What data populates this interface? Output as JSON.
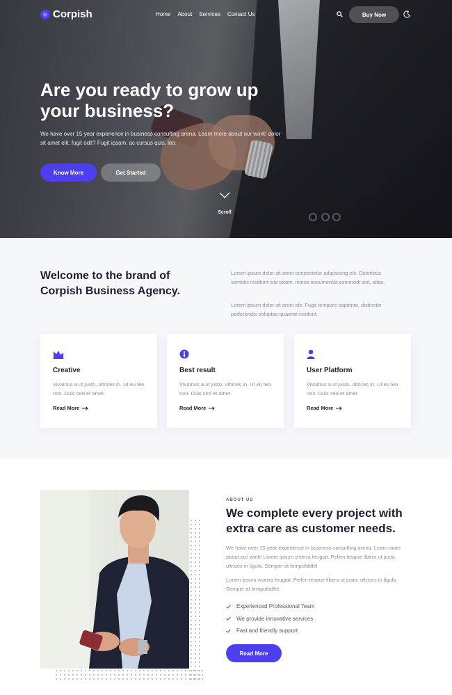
{
  "brand": {
    "name": "Corpish",
    "accent": "#4c3ff0"
  },
  "nav": {
    "items": [
      "Home",
      "About",
      "Services",
      "Contact Us"
    ],
    "buy_label": "Buy Now",
    "icons": [
      "search-icon",
      "moon-icon"
    ]
  },
  "hero": {
    "title": "Are you ready to grow up your business?",
    "subtitle": "We have over 15 year experience in business consulting arena. Learn more about our work! dolor sit amet elit. fugit odit? Fugit ipsam. ac cursus quis, leo.",
    "primary_button": "Know More",
    "secondary_button": "Get Started",
    "scroll_label": "Scroll"
  },
  "welcome": {
    "title": "Welcome to the brand of Corpish Business Agency.",
    "paragraph1": "Lorem ipsum dolor sit amet consectetur adipisicing elit. Doloribus veritatis incidunt iste totam, minus assumenda commodi sint, alias.",
    "paragraph2": "Lorem ipsum dolor sit amet elit. Fugit tempore sapiente, distinctio perferendis voluptas quaerat incidunt.",
    "cards": [
      {
        "icon": "chart-icon",
        "title": "Creative",
        "text": "Vivamus a ut justo, ultrices in. Ut eu leo non. Duis sed et amet.",
        "link": "Read More"
      },
      {
        "icon": "info-icon",
        "title": "Best result",
        "text": "Vivamus a ut justo, ultrices in. Ut eu leo non. Duis sed et amet.",
        "link": "Read More"
      },
      {
        "icon": "user-icon",
        "title": "User Platform",
        "text": "Vivamus a ut justo, ultrices in. Ut eu leo non. Duis sed et amet.",
        "link": "Read More"
      }
    ]
  },
  "about": {
    "eyebrow": "ABOUT US",
    "title": "We complete every project with extra care as customer needs.",
    "paragraph1": "We have over 15 year experience in business consulting arena. Learn more about our work! Lorem ipsum viverra feugiat. Pellen tesque libero ut justo, ultrices in ligula. Semper at tempufddfel",
    "paragraph2": "Lorem ipsum viverra feugiat. Pellen tesque libero ut justo, ultrices in ligula. Semper at tempufddfel.",
    "checklist": [
      "Experienced Professional Team",
      "We provide innovative services",
      "Fast and friendly support"
    ],
    "button": "Read More"
  }
}
